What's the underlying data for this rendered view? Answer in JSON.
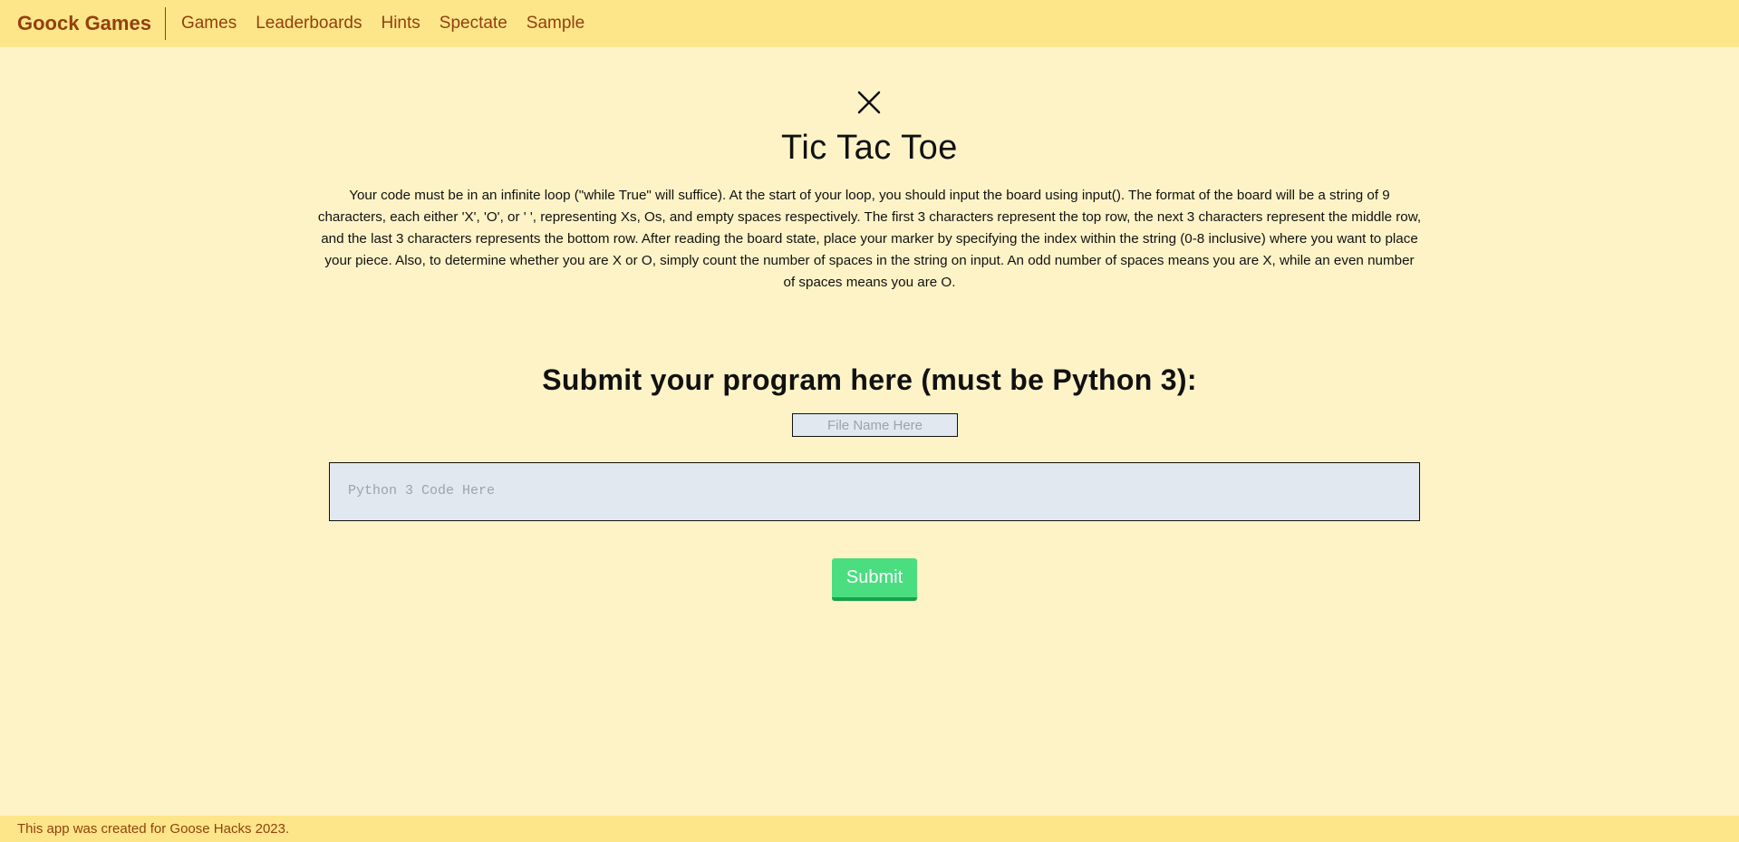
{
  "navbar": {
    "brand": "Goock Games",
    "links": [
      {
        "label": "Games"
      },
      {
        "label": "Leaderboards"
      },
      {
        "label": "Hints"
      },
      {
        "label": "Spectate"
      },
      {
        "label": "Sample"
      }
    ]
  },
  "game": {
    "icon": "x-mark-icon",
    "title": "Tic Tac Toe",
    "description": "Your code must be in an infinite loop (\"while True\" will suffice). At the start of your loop, you should input the board using input(). The format of the board will be a string of 9 characters, each either 'X', 'O', or ' ', representing Xs, Os, and empty spaces respectively. The first 3 characters represent the top row, the next 3 characters represent the middle row, and the last 3 characters represents the bottom row. After reading the board state, place your marker by specifying the index within the string (0-8 inclusive) where you want to place your piece. Also, to determine whether you are X or O, simply count the number of spaces in the string on input. An odd number of spaces means you are X, while an even number of spaces means you are O."
  },
  "submission": {
    "heading": "Submit your program here (must be Python 3):",
    "file_name_value": "",
    "file_name_placeholder": "File Name Here",
    "code_value": "",
    "code_placeholder": "Python 3 Code Here",
    "submit_label": "Submit"
  },
  "footer": {
    "text": "This app was created for Goose Hacks 2023."
  },
  "colors": {
    "background": "#fef3c7",
    "navbar": "#fde68a",
    "brand_text": "#92400e",
    "input_background": "#e2e8f0",
    "submit_button": "#4ade80"
  }
}
